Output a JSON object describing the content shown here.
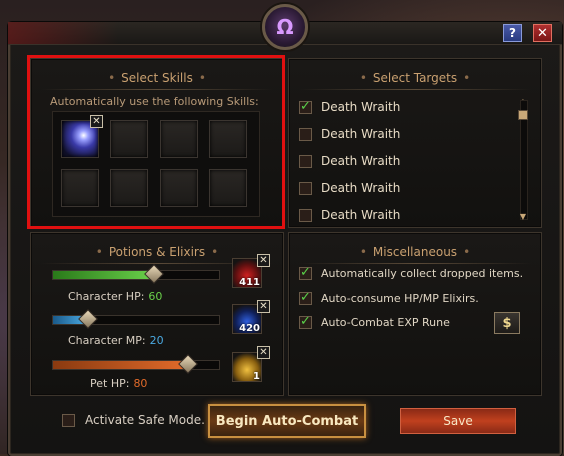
{
  "window": {
    "help_icon": "?",
    "close_icon": "✕",
    "emblem_icon": "Ω"
  },
  "skills": {
    "title": "Select Skills",
    "subtitle": "Automatically use the following Skills:",
    "remove_icon": "✕"
  },
  "targets": {
    "title": "Select Targets",
    "items": [
      {
        "label": "Death Wraith",
        "checked": true
      },
      {
        "label": "Death Wraith",
        "checked": false
      },
      {
        "label": "Death Wraith",
        "checked": false
      },
      {
        "label": "Death Wraith",
        "checked": false
      },
      {
        "label": "Death Wraith",
        "checked": false
      }
    ]
  },
  "potions": {
    "title": "Potions & Elixirs",
    "character_hp": {
      "label": "Character HP:",
      "value": "60",
      "color": "#6ad04a"
    },
    "character_mp": {
      "label": "Character MP:",
      "value": "20",
      "color": "#4aa8e0"
    },
    "pet_hp": {
      "label": "Pet HP:",
      "value": "80",
      "color": "#e06a2a"
    },
    "hp_potion_count": "411",
    "mp_potion_count": "420",
    "pet_potion_count": "1"
  },
  "misc": {
    "title": "Miscellaneous",
    "items": [
      {
        "label": "Automatically collect dropped items.",
        "checked": true
      },
      {
        "label": "Auto-consume HP/MP Elixirs.",
        "checked": true
      },
      {
        "label": "Auto-Combat EXP Rune",
        "checked": true
      }
    ],
    "dollar_icon": "$"
  },
  "footer": {
    "safe_mode_label": "Activate Safe Mode.",
    "combat_button": "Begin Auto-Combat",
    "save_button": "Save"
  }
}
